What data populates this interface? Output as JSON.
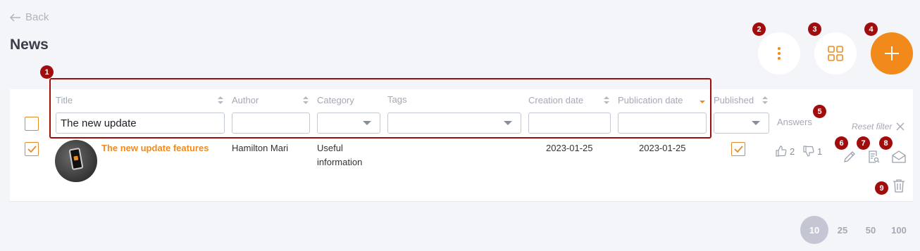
{
  "header": {
    "back_label": "Back",
    "title": "News"
  },
  "markers": [
    "1",
    "2",
    "3",
    "4",
    "5",
    "6",
    "7",
    "8",
    "9"
  ],
  "table": {
    "columns": {
      "title": "Title",
      "author": "Author",
      "category": "Category",
      "tags": "Tags",
      "creation_date": "Creation date",
      "publication_date": "Publication date",
      "published": "Published",
      "answers": "Answers"
    },
    "filters": {
      "title_value": "The new update",
      "author_value": "",
      "creation_date_value": "",
      "publication_date_value": ""
    },
    "reset_filter_label": "Reset filter",
    "rows": [
      {
        "selected": true,
        "title": "The new update features",
        "author": "Hamilton Mari",
        "category": "Useful information",
        "tags": "",
        "creation_date": "2023-01-25",
        "publication_date": "2023-01-25",
        "published": true,
        "likes": "2",
        "dislikes": "1"
      }
    ]
  },
  "pagination": {
    "options": [
      "10",
      "25",
      "50",
      "100"
    ],
    "selected": "10"
  },
  "colors": {
    "accent": "#f28a1b",
    "marker": "#a10c0c",
    "checkbox": "#e38a2a"
  }
}
